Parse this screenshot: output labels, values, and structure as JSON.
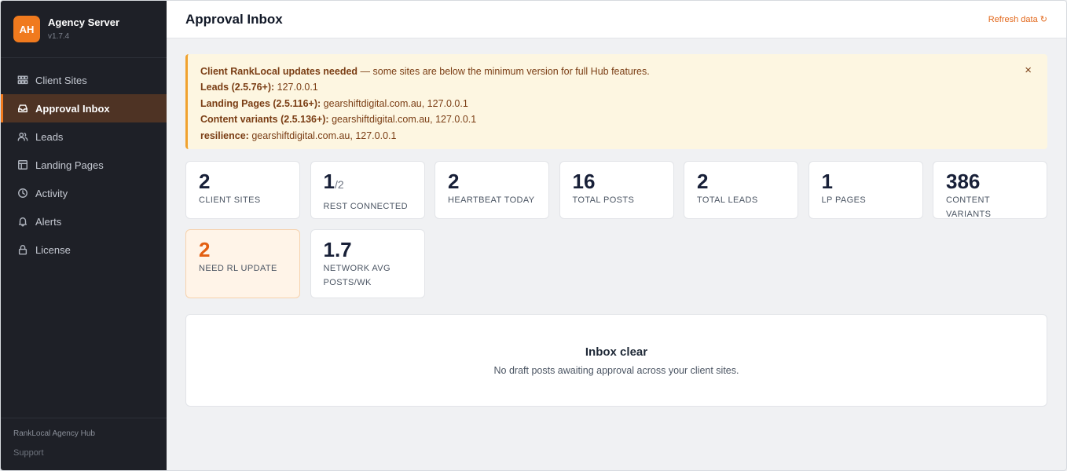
{
  "brand": {
    "logo": "AH",
    "name": "Agency Server",
    "version": "v1.7.4"
  },
  "nav": [
    {
      "label": "Client Sites",
      "icon": "grid-icon",
      "active": false
    },
    {
      "label": "Approval Inbox",
      "icon": "inbox-icon",
      "active": true
    },
    {
      "label": "Leads",
      "icon": "users-icon",
      "active": false
    },
    {
      "label": "Landing Pages",
      "icon": "layout-icon",
      "active": false
    },
    {
      "label": "Activity",
      "icon": "clock-icon",
      "active": false
    },
    {
      "label": "Alerts",
      "icon": "bell-icon",
      "active": false
    },
    {
      "label": "License",
      "icon": "lock-icon",
      "active": false
    }
  ],
  "sidebar_footer": {
    "product": "RankLocal Agency Hub",
    "support": "Support"
  },
  "header": {
    "title": "Approval Inbox",
    "refresh": "Refresh data ↻"
  },
  "alert": {
    "heading": "Client RankLocal updates needed",
    "heading_rest": " — some sites are below the minimum version for full Hub features.",
    "close": "×",
    "rows": [
      {
        "label": "Leads (2.5.76+):",
        "value": " 127.0.0.1"
      },
      {
        "label": "Landing Pages (2.5.116+):",
        "value": " gearshiftdigital.com.au, 127.0.0.1"
      },
      {
        "label": "Content variants (2.5.136+):",
        "value": " gearshiftdigital.com.au, 127.0.0.1"
      },
      {
        "label": "resilience:",
        "value": " gearshiftdigital.com.au, 127.0.0.1"
      }
    ]
  },
  "stats": {
    "client_sites": {
      "value": "2",
      "label": "CLIENT SITES"
    },
    "rest_connected": {
      "value": "1",
      "sub": "/2",
      "label": "REST CONNECTED"
    },
    "heartbeat_today": {
      "value": "2",
      "label": "HEARTBEAT TODAY"
    },
    "total_posts": {
      "value": "16",
      "label": "TOTAL POSTS"
    },
    "total_leads": {
      "value": "2",
      "label": "TOTAL LEADS"
    },
    "lp_pages": {
      "value": "1",
      "label": "LP PAGES"
    },
    "content_variants": {
      "value": "386",
      "label": "CONTENT VARIANTS"
    },
    "need_rl_update": {
      "value": "2",
      "label": "NEED RL UPDATE"
    },
    "network_avg": {
      "value": "1.7",
      "label": "NETWORK AVG POSTS/WK"
    }
  },
  "empty_state": {
    "title": "Inbox clear",
    "description": "No draft posts awaiting approval across your client sites."
  },
  "colors": {
    "accent": "#f07a1e",
    "sidebar": "#1e2027",
    "alert_bg": "#fdf6e1",
    "alert_border": "#f0a22e",
    "warn_value": "#e35f12"
  }
}
